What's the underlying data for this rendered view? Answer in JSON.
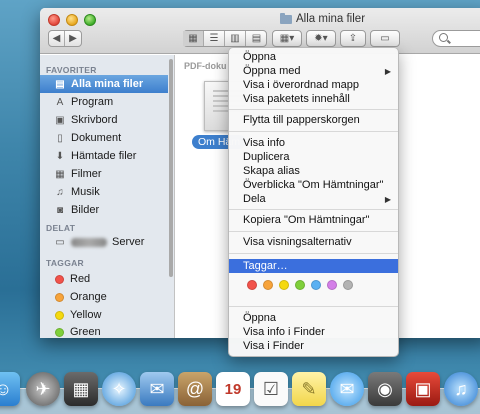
{
  "window": {
    "title": "Alla mina filer"
  },
  "toolbar": {
    "back_icon": "back-arrow-icon",
    "forward_icon": "forward-arrow-icon"
  },
  "sidebar": {
    "favorites_header": "FAVORITER",
    "favorites": [
      {
        "label": "Alla mina filer",
        "icon": "all-files-icon"
      },
      {
        "label": "Program",
        "icon": "applications-icon"
      },
      {
        "label": "Skrivbord",
        "icon": "desktop-icon"
      },
      {
        "label": "Dokument",
        "icon": "documents-icon"
      },
      {
        "label": "Hämtade filer",
        "icon": "downloads-icon"
      },
      {
        "label": "Filmer",
        "icon": "movies-icon"
      },
      {
        "label": "Musik",
        "icon": "music-icon"
      },
      {
        "label": "Bilder",
        "icon": "pictures-icon"
      }
    ],
    "shared_header": "DELAT",
    "shared": [
      {
        "label": "Server",
        "icon": "display-icon"
      }
    ],
    "tags_header": "TAGGAR",
    "tags": [
      {
        "label": "Red",
        "color": "#f2524a"
      },
      {
        "label": "Orange",
        "color": "#f7a33a"
      },
      {
        "label": "Yellow",
        "color": "#f5d90f"
      },
      {
        "label": "Green",
        "color": "#7fcf3a"
      }
    ]
  },
  "content": {
    "path_label": "PDF-doku",
    "file_label": "Om Häm"
  },
  "context_menu": {
    "items": [
      {
        "label": "Öppna"
      },
      {
        "label": "Öppna med",
        "submenu": true
      },
      {
        "label": "Visa i överordnad mapp"
      },
      {
        "label": "Visa paketets innehåll"
      },
      {
        "label": "Flytta till papperskorgen"
      },
      {
        "label": "Visa info"
      },
      {
        "label": "Duplicera"
      },
      {
        "label": "Skapa alias"
      },
      {
        "label": "Överblicka \"Om Hämtningar\""
      },
      {
        "label": "Dela",
        "submenu": true
      },
      {
        "label": "Kopiera \"Om Hämtningar\""
      },
      {
        "label": "Visa visningsalternativ"
      },
      {
        "label": "Taggar…",
        "highlighted": true
      },
      {
        "label": "Öppna"
      },
      {
        "label": "Visa info i Finder"
      },
      {
        "label": "Visa i Finder"
      }
    ],
    "tag_colors": [
      "#f2524a",
      "#f7a33a",
      "#f5d90f",
      "#7fcf3a",
      "#5ab0f2",
      "#d47fe8",
      "#b3b3b3"
    ]
  },
  "dock": {
    "icons": [
      "finder-icon",
      "launchpad-icon",
      "mission-control-icon",
      "safari-icon",
      "mail-icon",
      "contacts-icon",
      "calendar-icon",
      "reminders-icon",
      "notes-icon",
      "messages-icon",
      "facetime-icon",
      "photo-booth-icon",
      "itunes-icon"
    ]
  }
}
